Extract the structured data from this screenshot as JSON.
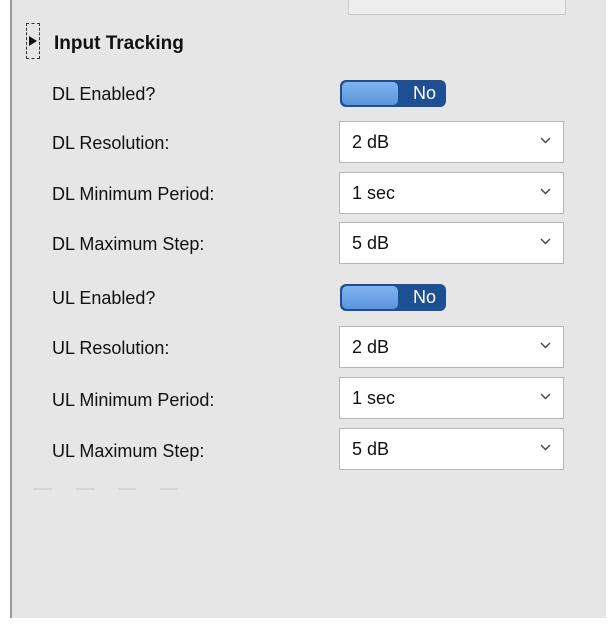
{
  "section": {
    "title": "Input Tracking",
    "expander_icon": "triangle-right-icon"
  },
  "rows": {
    "dl_enabled": {
      "label": "DL Enabled?",
      "toggle_text": "No",
      "state": false
    },
    "dl_resolution": {
      "label": "DL Resolution:",
      "value": "2 dB"
    },
    "dl_min_period": {
      "label": "DL Minimum Period:",
      "value": "1 sec"
    },
    "dl_max_step": {
      "label": "DL Maximum Step:",
      "value": "5 dB"
    },
    "ul_enabled": {
      "label": "UL Enabled?",
      "toggle_text": "No",
      "state": false
    },
    "ul_resolution": {
      "label": "UL Resolution:",
      "value": "2 dB"
    },
    "ul_min_period": {
      "label": "UL Minimum Period:",
      "value": "1 sec"
    },
    "ul_max_step": {
      "label": "UL Maximum Step:",
      "value": "5 dB"
    }
  },
  "colors": {
    "panel_bg": "#e6e6e6",
    "toggle_bg": "#1f4f93",
    "toggle_knob": "#6aa3e4"
  }
}
